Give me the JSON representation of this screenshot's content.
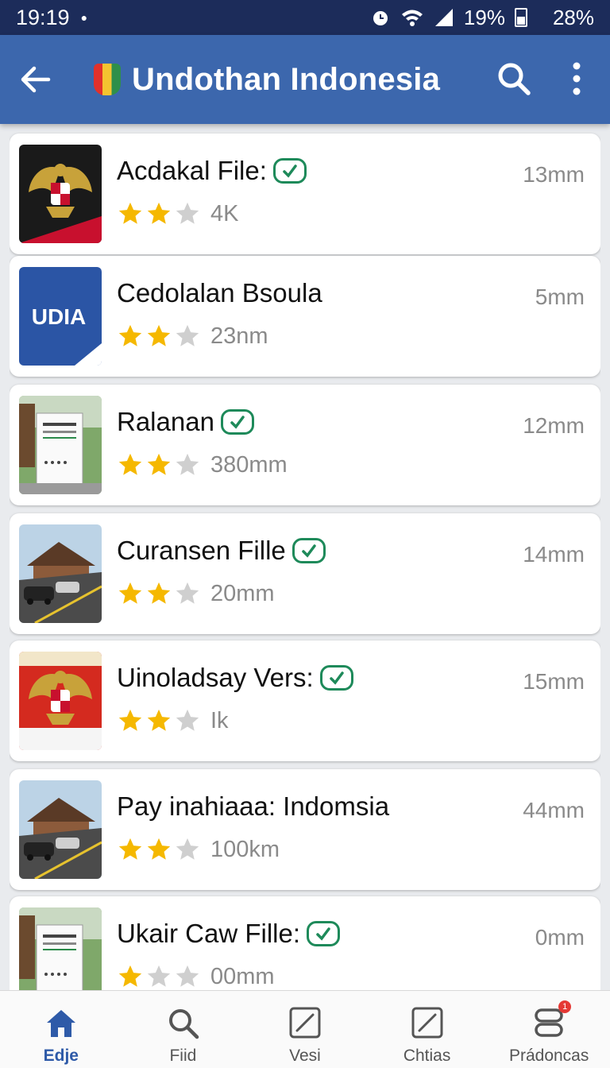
{
  "status_bar": {
    "time": "19:19",
    "battery_percent": "19%",
    "extra": "28%"
  },
  "app_bar": {
    "title": "Undothan Indonesia"
  },
  "items": [
    {
      "title": "Acdakal File:",
      "verified": true,
      "time": "13mm",
      "rating": 2,
      "meta": "4K",
      "thumb": "garuda-emblem"
    },
    {
      "title": "Cedolalan Bsoula",
      "verified": false,
      "time": "5mm",
      "rating": 2,
      "meta": "23nm",
      "thumb": "udia-logo",
      "thumb_text": "UDIA"
    },
    {
      "title": "Ralanan",
      "verified": true,
      "time": "12mm",
      "rating": 2,
      "meta": "380mm",
      "thumb": "poster-board"
    },
    {
      "title": "Curansen Fille",
      "verified": true,
      "time": "14mm",
      "rating": 2,
      "meta": "20mm",
      "thumb": "street-scene"
    },
    {
      "title": "Uinoladsay Vers:",
      "verified": true,
      "time": "15mm",
      "rating": 2,
      "meta": "Ik",
      "thumb": "garuda-red"
    },
    {
      "title": "Pay inahiaaa:  Indomsia",
      "verified": false,
      "time": "44mm",
      "rating": 2,
      "meta": "100km",
      "thumb": "street-scene"
    },
    {
      "title": "Ukair Caw Fille:",
      "verified": true,
      "time": "0mm",
      "rating": 1,
      "meta": "00mm",
      "thumb": "poster-board"
    }
  ],
  "nav": [
    {
      "label": "Edje",
      "icon": "home-icon",
      "active": true
    },
    {
      "label": "Fiid",
      "icon": "search-icon",
      "active": false
    },
    {
      "label": "Vesi",
      "icon": "edit-icon",
      "active": false
    },
    {
      "label": "Chtias",
      "icon": "edit-icon",
      "active": false
    },
    {
      "label": "Prádoncas",
      "icon": "layers-icon",
      "active": false,
      "badge": "1"
    }
  ],
  "colors": {
    "app_bar": "#3c67ad",
    "status_bar": "#1c2c5a",
    "accent": "#2e5aa8",
    "verified": "#1e8a5a",
    "star": "#f5b800"
  }
}
